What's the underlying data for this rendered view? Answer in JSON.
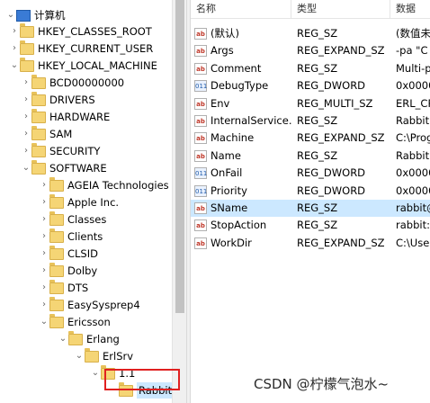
{
  "tree": {
    "nodes": [
      {
        "label": "计算机",
        "expanded": true
      },
      {
        "label": "HKEY_CLASSES_ROOT",
        "expanded": false
      },
      {
        "label": "HKEY_CURRENT_USER",
        "expanded": false
      },
      {
        "label": "HKEY_LOCAL_MACHINE",
        "expanded": true
      },
      {
        "label": "BCD00000000",
        "expanded": false
      },
      {
        "label": "DRIVERS",
        "expanded": false
      },
      {
        "label": "HARDWARE",
        "expanded": false
      },
      {
        "label": "SAM",
        "expanded": false
      },
      {
        "label": "SECURITY",
        "expanded": false
      },
      {
        "label": "SOFTWARE",
        "expanded": true
      },
      {
        "label": "AGEIA Technologies",
        "expanded": false
      },
      {
        "label": "Apple Inc.",
        "expanded": false
      },
      {
        "label": "Classes",
        "expanded": false
      },
      {
        "label": "Clients",
        "expanded": false
      },
      {
        "label": "CLSID",
        "expanded": false
      },
      {
        "label": "Dolby",
        "expanded": false
      },
      {
        "label": "DTS",
        "expanded": false
      },
      {
        "label": "EasySysprep4",
        "expanded": false
      },
      {
        "label": "Ericsson",
        "expanded": true
      },
      {
        "label": "Erlang",
        "expanded": true
      },
      {
        "label": "ErlSrv",
        "expanded": true
      },
      {
        "label": "1.1",
        "expanded": true
      },
      {
        "label": "RabbitM",
        "selected": true
      }
    ]
  },
  "list": {
    "headers": {
      "name": "名称",
      "type": "类型",
      "data": "数据"
    },
    "rows": [
      {
        "icon": "sz",
        "name": "(默认)",
        "type": "REG_SZ",
        "data": "(数值未"
      },
      {
        "icon": "sz",
        "name": "Args",
        "type": "REG_EXPAND_SZ",
        "data": " -pa \"C"
      },
      {
        "icon": "sz",
        "name": "Comment",
        "type": "REG_SZ",
        "data": "Multi-p"
      },
      {
        "icon": "bin",
        "name": "DebugType",
        "type": "REG_DWORD",
        "data": "0x0000"
      },
      {
        "icon": "sz",
        "name": "Env",
        "type": "REG_MULTI_SZ",
        "data": "ERL_CR"
      },
      {
        "icon": "sz",
        "name": "InternalService...",
        "type": "REG_SZ",
        "data": "Rabbit"
      },
      {
        "icon": "sz",
        "name": "Machine",
        "type": "REG_EXPAND_SZ",
        "data": "C:\\Prog"
      },
      {
        "icon": "sz",
        "name": "Name",
        "type": "REG_SZ",
        "data": "Rabbit"
      },
      {
        "icon": "bin",
        "name": "OnFail",
        "type": "REG_DWORD",
        "data": "0x0000"
      },
      {
        "icon": "bin",
        "name": "Priority",
        "type": "REG_DWORD",
        "data": "0x0000"
      },
      {
        "icon": "sz",
        "name": "SName",
        "type": "REG_SZ",
        "data": "rabbit@",
        "selected": true
      },
      {
        "icon": "sz",
        "name": "StopAction",
        "type": "REG_SZ",
        "data": "rabbit:s"
      },
      {
        "icon": "sz",
        "name": "WorkDir",
        "type": "REG_EXPAND_SZ",
        "data": "C:\\User"
      }
    ]
  },
  "icons": {
    "sz": "ab",
    "bin": "011"
  },
  "watermark": "CSDN @柠檬气泡水~"
}
